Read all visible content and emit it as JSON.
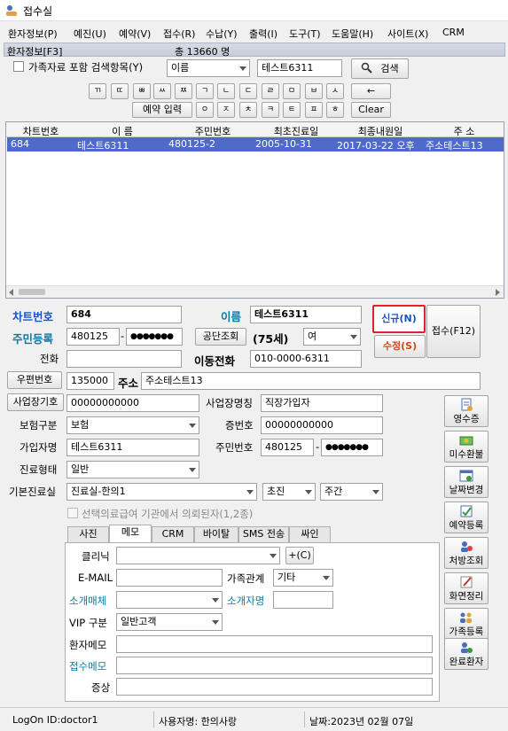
{
  "window": {
    "title": "접수실"
  },
  "menu": [
    "환자정보(P)",
    "예진(U)",
    "예약(V)",
    "접수(R)",
    "수납(Y)",
    "출력(I)",
    "도구(T)",
    "도움말(H)",
    "사이트(X)",
    "CRM"
  ],
  "section": {
    "title": "환자정보[F3]",
    "total": "총 13660 명"
  },
  "search": {
    "family_checkbox": "가족자료 포함 검색항목(Y)",
    "field": "이름",
    "query": "테스트6311",
    "search_button": "검색"
  },
  "keys_row1": [
    "ㄲ",
    "ㄸ",
    "ㅃ",
    "ㅆ",
    "ㅉ",
    "ㄱ",
    "ㄴ",
    "ㄷ",
    "ㄹ",
    "ㅁ",
    "ㅂ",
    "ㅅ"
  ],
  "keys_row2": [
    "ㅇ",
    "ㅈ",
    "ㅊ",
    "ㅋ",
    "ㅌ",
    "ㅍ",
    "ㅎ"
  ],
  "reservation_input": "예약 입력",
  "backspace": "←",
  "clear": "Clear",
  "table": {
    "headers": [
      "차트번호",
      "이 름",
      "주민번호",
      "최초진료일",
      "최종내원일",
      "주 소"
    ],
    "rows": [
      [
        "684",
        "테스트6311",
        "480125-2",
        "2005-10-31",
        "2017-03-22 오후",
        "주소테스트13"
      ]
    ]
  },
  "patient": {
    "chart_no_label": "차트번호",
    "chart_no": "684",
    "name_label": "이름",
    "name": "테스트6311",
    "rrn_label": "주민등록",
    "rrn_front": "480125",
    "rrn_back": "●●●●●●●",
    "public_check": "공단조회",
    "age": "(75세)",
    "gender": "여",
    "phone_label": "전화",
    "phone": "",
    "mobile_label": "이동전화",
    "mobile": "010-0000-6311",
    "zip_button": "우편번호",
    "zip": "135000",
    "addr_label": "주소",
    "addr": "주소테스트13",
    "biz_no_label": "사업장기호",
    "biz_no": "00000000000",
    "biz_name_label": "사업장명칭",
    "biz_name": "직장가입자",
    "insurance_label": "보험구분",
    "insurance": "보험",
    "cert_label": "증번호",
    "cert": "00000000000",
    "subscriber_label": "가입자명",
    "subscriber": "테스트6311",
    "sub_rrn_label": "주민번호",
    "sub_rrn_front": "480125",
    "sub_rrn_back": "●●●●●●●",
    "treat_type_label": "진료형태",
    "treat_type": "일반",
    "room_label": "기본진료실",
    "room": "진료실-한의1",
    "visit": "초진",
    "time": "주간",
    "medical_aid": "선택의료급여 기관에서 의뢰된자(1,2종)"
  },
  "actions": {
    "new": "신규(N)",
    "edit": "수정(S)",
    "receive": "접수(F12)"
  },
  "side_buttons": [
    "영수증",
    "미수환불",
    "날짜변경",
    "예약등록",
    "처방조회",
    "화면정리",
    "가족등록",
    "완료환자"
  ],
  "tabs": [
    "사진",
    "메모",
    "CRM",
    "바이탈",
    "SMS 전송",
    "싸인"
  ],
  "memo": {
    "clinic_label": "클리닉",
    "clinic_add": "+(C)",
    "email_label": "E-MAIL",
    "email": "",
    "family_label": "가족관계",
    "family": "기타",
    "media_label": "소개매체",
    "media": "",
    "introducer_label": "소개자명",
    "introducer": "",
    "vip_label": "VIP 구분",
    "vip": "일반고객",
    "patient_memo_label": "환자메모",
    "reception_memo_label": "접수메모",
    "symptom_label": "증상"
  },
  "status": {
    "logon": "LogOn ID:doctor1",
    "user": "사용자명: 한의사랑",
    "date": "날짜:2023년 02월 07일"
  },
  "colors": {
    "selection": "#4f6acb",
    "blue_label": "#1a55c4",
    "teal_label": "#0a7aa3",
    "new_highlight": "#e0202a",
    "edit": "#d2461e"
  }
}
